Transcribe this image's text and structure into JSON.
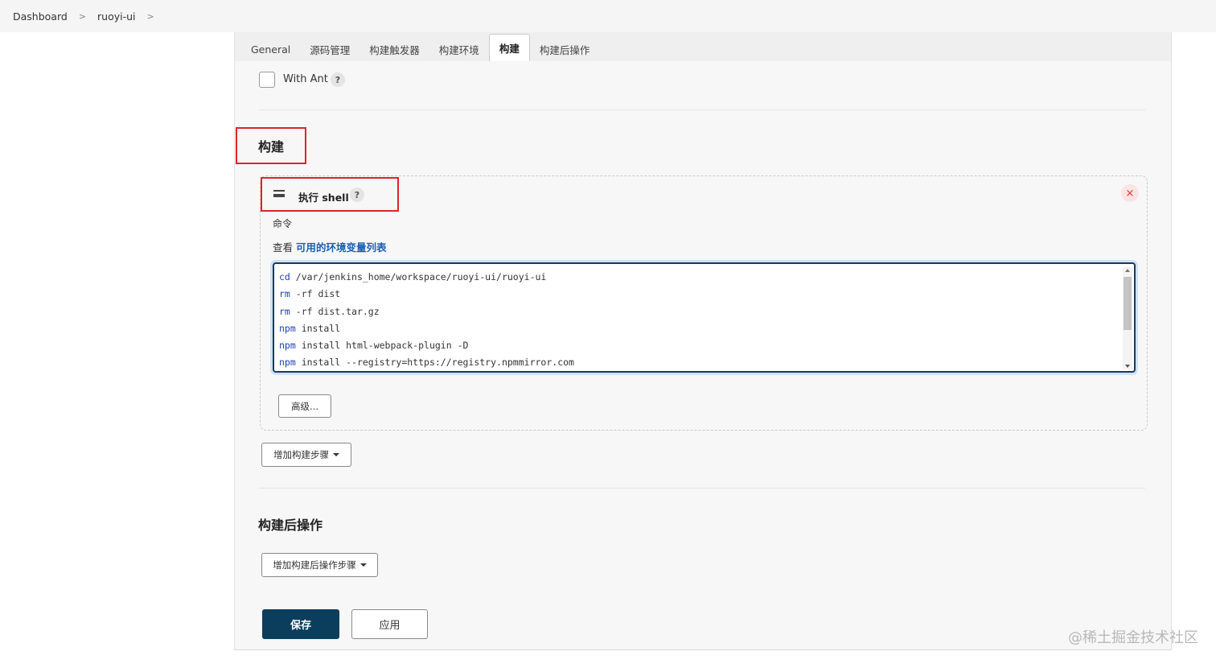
{
  "breadcrumb": {
    "items": [
      "Dashboard",
      "ruoyi-ui"
    ],
    "separator": ">"
  },
  "tabs": [
    {
      "label": "General"
    },
    {
      "label": "源码管理"
    },
    {
      "label": "构建触发器"
    },
    {
      "label": "构建环境"
    },
    {
      "label": "构建",
      "active": true
    },
    {
      "label": "构建后操作"
    }
  ],
  "with_ant": {
    "label": "With Ant",
    "checked": false,
    "help": "?"
  },
  "build_section": {
    "title": "构建"
  },
  "step": {
    "title": "执行 shell",
    "help": "?",
    "close": "×",
    "command_label": "命令",
    "env_prefix": "查看 ",
    "env_link": "可用的环境变量列表",
    "code_lines": [
      {
        "kw": "cd",
        "rest": " /var/jenkins_home/workspace/ruoyi-ui/ruoyi-ui"
      },
      {
        "kw": "rm",
        "rest": " -rf dist"
      },
      {
        "kw": "rm",
        "rest": " -rf dist.tar.gz"
      },
      {
        "kw": "npm",
        "rest": "  install"
      },
      {
        "kw": "npm",
        "rest": " install html-webpack-plugin -D"
      },
      {
        "kw": "npm",
        "rest": " install --registry=https://registry.npmmirror.com"
      }
    ],
    "advanced_label": "高级..."
  },
  "add_build_step_label": "增加构建步骤",
  "post_build_section": {
    "title": "构建后操作"
  },
  "add_post_build_step_label": "增加构建后操作步骤",
  "save_label": "保存",
  "apply_label": "应用",
  "watermark": "@稀土掘金技术社区",
  "colors": {
    "accent": "#0b3d5c",
    "highlight": "#e0232b",
    "link": "#1a5fb4"
  }
}
